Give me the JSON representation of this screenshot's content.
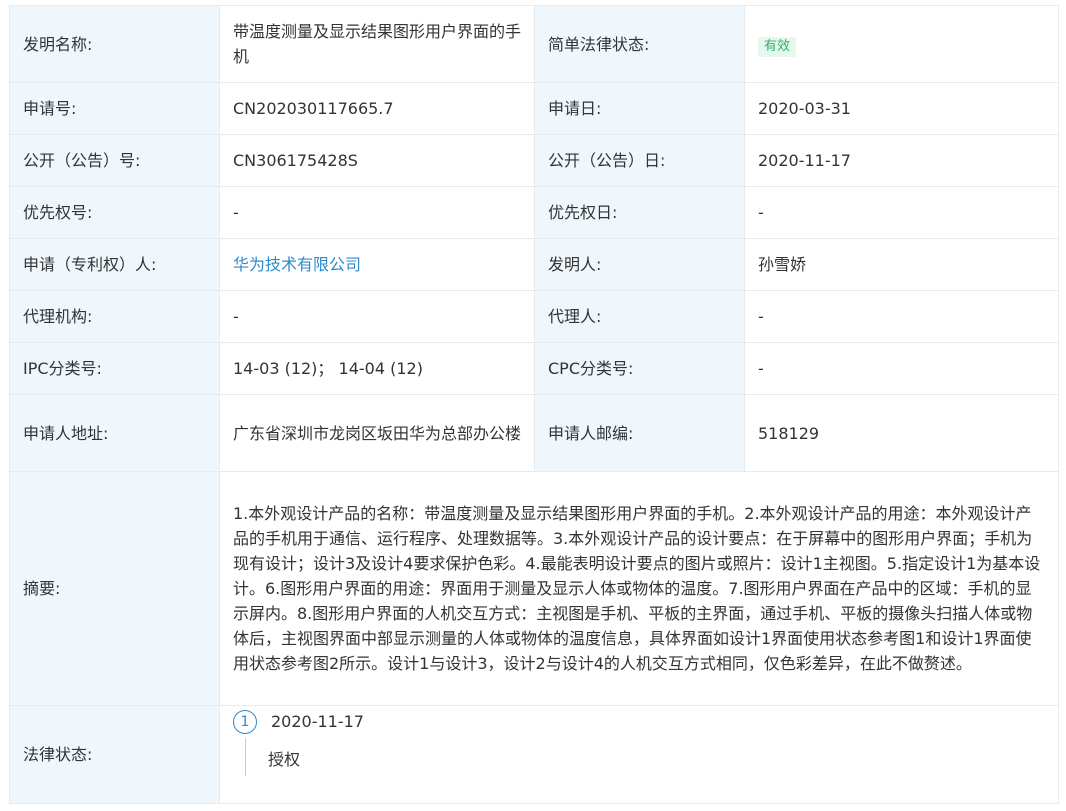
{
  "labels": {
    "invention_name": "发明名称:",
    "legal_status_simple": "简单法律状态:",
    "app_no": "申请号:",
    "app_date": "申请日:",
    "pub_no": "公开（公告）号:",
    "pub_date": "公开（公告）日:",
    "priority_no": "优先权号:",
    "priority_date": "优先权日:",
    "applicant": "申请（专利权）人:",
    "inventor": "发明人:",
    "agency": "代理机构:",
    "agent": "代理人:",
    "ipc": "IPC分类号:",
    "cpc": "CPC分类号:",
    "address": "申请人地址:",
    "postcode": "申请人邮编:",
    "abstract": "摘要:",
    "legal_status": "法律状态:"
  },
  "values": {
    "invention_name": "带温度测量及显示结果图形用户界面的手机",
    "legal_status_simple": "有效",
    "app_no": "CN202030117665.7",
    "app_date": "2020-03-31",
    "pub_no": "CN306175428S",
    "pub_date": "2020-11-17",
    "priority_no": "-",
    "priority_date": "-",
    "applicant": "华为技术有限公司",
    "inventor": "孙雪娇",
    "agency": "-",
    "agent": "-",
    "ipc": "14-03 (12)； 14-04 (12)",
    "cpc": "-",
    "address": "广东省深圳市龙岗区坂田华为总部办公楼",
    "postcode": "518129",
    "abstract": "1.本外观设计产品的名称：带温度测量及显示结果图形用户界面的手机。2.本外观设计产品的用途：本外观设计产品的手机用于通信、运行程序、处理数据等。3.本外观设计产品的设计要点：在于屏幕中的图形用户界面；手机为现有设计；设计3及设计4要求保护色彩。4.最能表明设计要点的图片或照片：设计1主视图。5.指定设计1为基本设计。6.图形用户界面的用途：界面用于测量及显示人体或物体的温度。7.图形用户界面在产品中的区域：手机的显示屏内。8.图形用户界面的人机交互方式：主视图是手机、平板的主界面，通过手机、平板的摄像头扫描人体或物体后，主视图界面中部显示测量的人体或物体的温度信息，具体界面如设计1界面使用状态参考图1和设计1界面使用状态参考图2所示。设计1与设计3，设计2与设计4的人机交互方式相同，仅色彩差异，在此不做赘述。"
  },
  "legal_events": [
    {
      "index": "1",
      "date": "2020-11-17",
      "status": "授权"
    }
  ],
  "colors": {
    "label_bg": "#f0f7fc",
    "border": "#e6ebf2",
    "link": "#2e8bcb",
    "badge_bg": "#e6f7ee",
    "badge_text": "#2db56c"
  }
}
